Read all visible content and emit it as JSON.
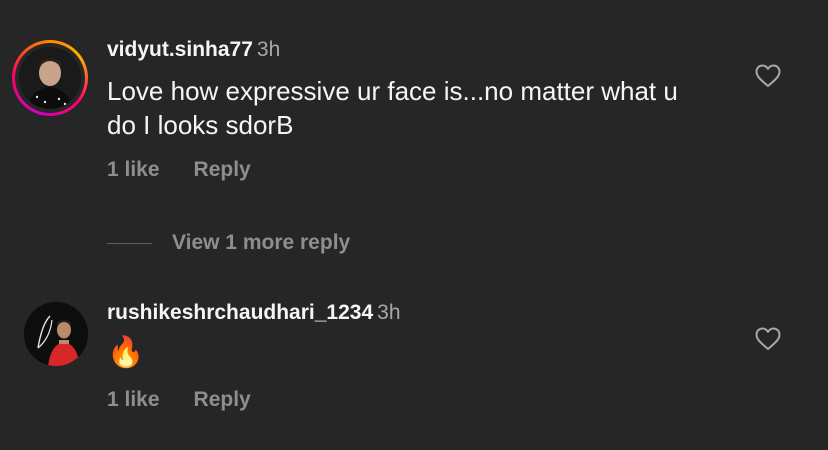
{
  "comments": [
    {
      "username": "vidyut.sinha77",
      "time": "3h",
      "text": "Love how expressive ur face is...no matter what u do I looks sdorB",
      "likes_label": "1 like",
      "reply_label": "Reply",
      "view_more_label": "View 1 more reply",
      "has_story_ring": true
    },
    {
      "username": "rushikeshrchaudhari_1234",
      "time": "3h",
      "text": "🔥",
      "likes_label": "1 like",
      "reply_label": "Reply",
      "has_story_ring": false
    }
  ],
  "icons": {
    "like": "heart-outline-icon"
  },
  "colors": {
    "background": "#262626",
    "primary_text": "#f5f5f5",
    "secondary_text": "#8e8e8e",
    "story_ring": [
      "#d300c5",
      "#ff0069",
      "#ff7a00",
      "#ffb300"
    ]
  }
}
